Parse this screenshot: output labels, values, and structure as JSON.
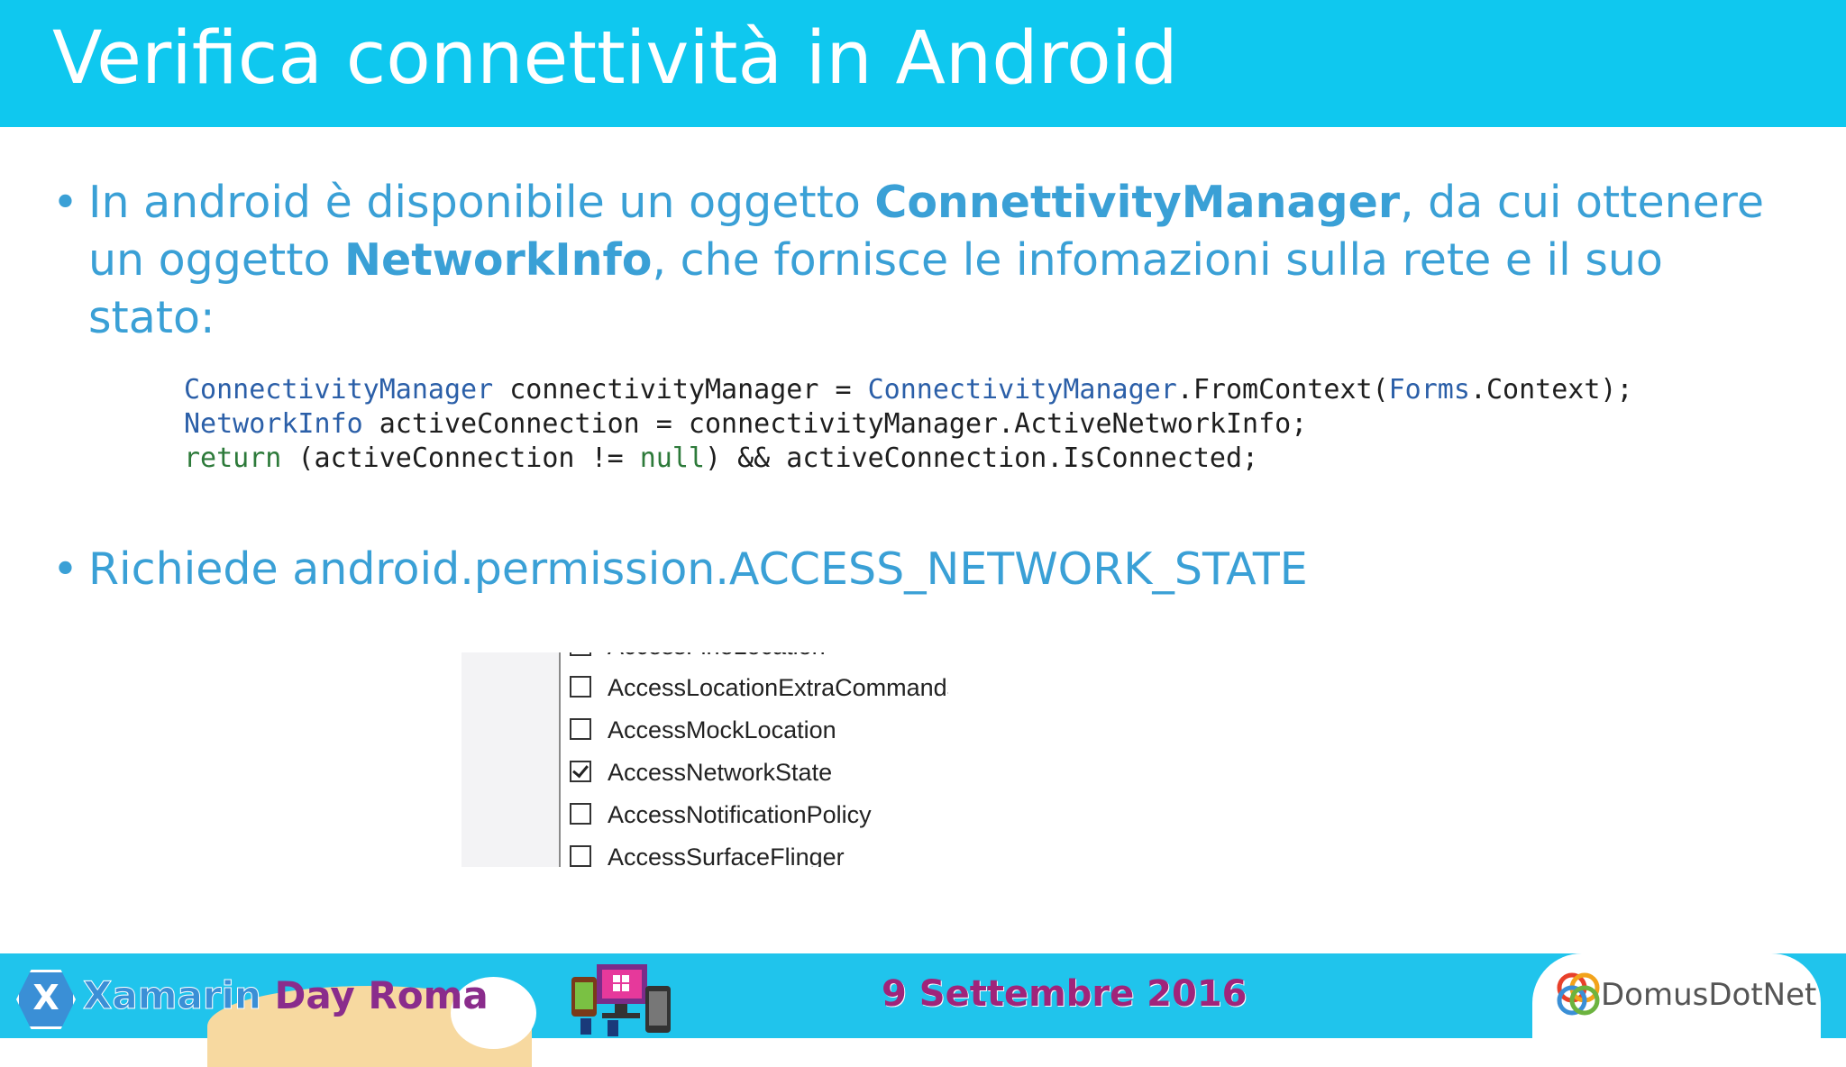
{
  "slide": {
    "title": "Verifica connettività in Android",
    "bullets": [
      {
        "marker": "•",
        "parts": [
          {
            "text": "In android è disponibile un oggetto ",
            "bold": false
          },
          {
            "text": "ConnettivityManager",
            "bold": true
          },
          {
            "text": ", da cui ottenere un oggetto ",
            "bold": false
          },
          {
            "text": "NetworkInfo",
            "bold": true
          },
          {
            "text": ", che fornisce le infomazioni sulla rete e il suo stato:",
            "bold": false
          }
        ]
      },
      {
        "marker": "•",
        "parts": [
          {
            "text": "Richiede android.permission.ACCESS_NETWORK_STATE",
            "bold": false
          }
        ]
      }
    ],
    "code": {
      "line1": {
        "t1": "ConnectivityManager",
        "t2": " connectivityManager = ",
        "t3": "ConnectivityManager",
        "t4": ".FromContext(",
        "t5": "Forms",
        "t6": ".Context);"
      },
      "line2": {
        "t1": "NetworkInfo",
        "t2": " activeConnection = connectivityManager.ActiveNetworkInfo;"
      },
      "line3": {
        "t1": "return",
        "t2": " (activeConnection != ",
        "t3": "null",
        "t4": ") && activeConnection.IsConnected;"
      }
    },
    "permissions": [
      {
        "label": "AccessFineLocation",
        "checked": false
      },
      {
        "label": "AccessLocationExtraCommands",
        "checked": false
      },
      {
        "label": "AccessMockLocation",
        "checked": false
      },
      {
        "label": "AccessNetworkState",
        "checked": true
      },
      {
        "label": "AccessNotificationPolicy",
        "checked": false
      },
      {
        "label": "AccessSurfaceFlinger",
        "checked": false
      }
    ]
  },
  "footer": {
    "brand_part1": "Xamarin",
    "brand_part2": " Day Roma",
    "date": "9 Settembre 2016",
    "sponsor": "DomusDotNet",
    "logo_letter": "X",
    "devices_icon": "devices-windows-ios-android-icon"
  },
  "colors": {
    "title_bar": "#0fc8ef",
    "bullet_text": "#3aa0d6",
    "code_type": "#2b5fa8",
    "code_keyword": "#2d7a3a",
    "footer_bar": "#20c4ec",
    "date_text": "#a0247a"
  }
}
